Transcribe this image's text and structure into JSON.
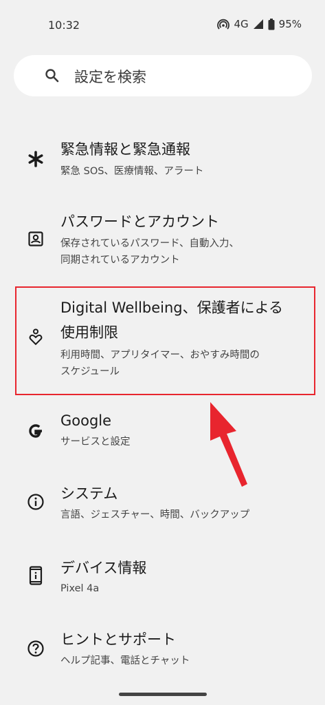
{
  "status": {
    "time": "10:32",
    "network": "4G",
    "battery": "95%"
  },
  "search": {
    "placeholder": "設定を検索"
  },
  "items": [
    {
      "title": "緊急情報と緊急通報",
      "subtitle": "緊急 SOS、医療情報、アラート",
      "icon": "asterisk-icon"
    },
    {
      "title": "パスワードとアカウント",
      "subtitle_line1": "保存されているパスワード、自動入力、",
      "subtitle_line2": "同期されているアカウント",
      "icon": "account-box-icon"
    },
    {
      "title_line1": "Digital Wellbeing、保護者による",
      "title_line2": "使用制限",
      "subtitle_line1": "利用時間、アプリタイマー、おやすみ時間の",
      "subtitle_line2": "スケジュール",
      "icon": "wellbeing-heart-icon"
    },
    {
      "title": "Google",
      "subtitle": "サービスと設定",
      "icon": "google-g-icon"
    },
    {
      "title": "システム",
      "subtitle": "言語、ジェスチャー、時間、バックアップ",
      "icon": "info-icon"
    },
    {
      "title": "デバイス情報",
      "subtitle": "Pixel 4a",
      "icon": "phone-info-icon"
    },
    {
      "title": "ヒントとサポート",
      "subtitle": "ヘルプ記事、電話とチャット",
      "icon": "help-icon"
    }
  ],
  "colors": {
    "highlight": "#e8252e",
    "background": "#f1f1f1"
  }
}
